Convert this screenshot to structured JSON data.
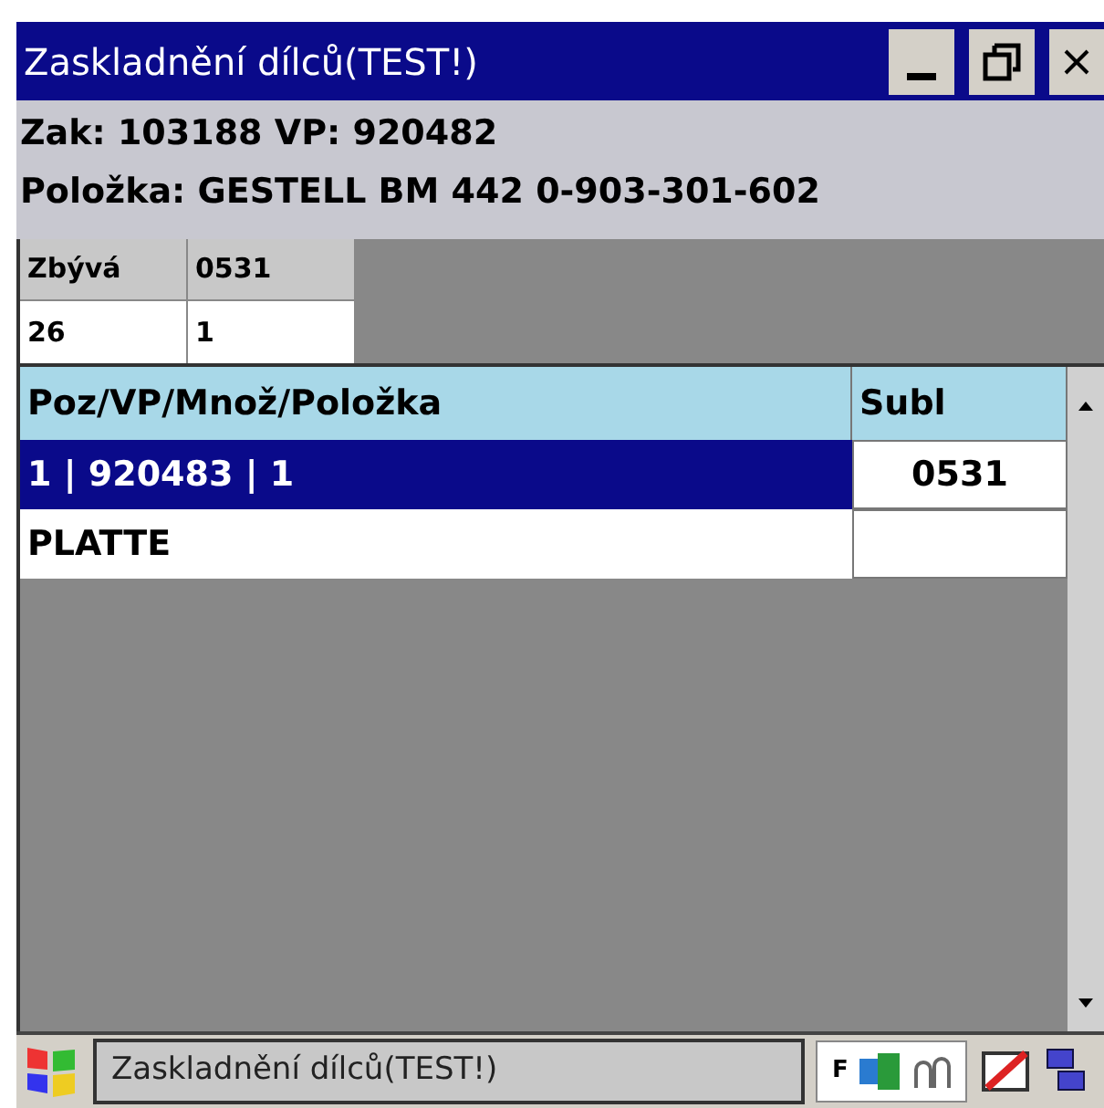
{
  "window": {
    "title": "Zaskladnění dílců(TEST!)"
  },
  "info": [
    "Zak: 103188 VP: 920482",
    "Položka: GESTELL BM 442 0-903-301-602"
  ],
  "summary": {
    "columns": [
      "Zbývá",
      "0531"
    ],
    "values": [
      "26",
      "1"
    ]
  },
  "grid": {
    "columns": [
      "Poz/VP/Množ/Položka",
      "Subl"
    ],
    "rows": [
      {
        "cells": [
          "1 | 920483 | 1",
          "0531"
        ],
        "selected": true
      },
      {
        "cells": [
          "PLATTE",
          ""
        ],
        "selected": false
      }
    ]
  },
  "taskbar": {
    "task": "Zaskladnění dílců(TEST!)",
    "input_mode": "F"
  }
}
